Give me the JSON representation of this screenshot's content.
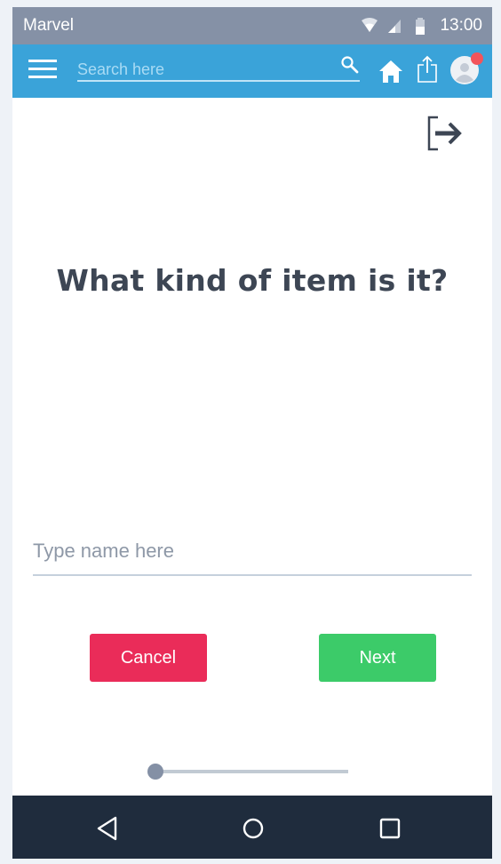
{
  "status_bar": {
    "carrier": "Marvel",
    "time": "13:00",
    "icons": [
      "wifi-icon",
      "signal-icon",
      "battery-icon"
    ]
  },
  "app_bar": {
    "menu_icon": "hamburger-menu-icon",
    "search": {
      "placeholder": "Search here",
      "value": "",
      "icon": "search-icon"
    },
    "actions": [
      "home-icon",
      "share-icon",
      "avatar-icon"
    ],
    "notification_color": "#f2545b"
  },
  "main": {
    "exit_icon": "exit-icon",
    "question": "What kind of item is it?",
    "name_input": {
      "placeholder": "Type name here",
      "value": ""
    },
    "buttons": {
      "cancel_label": "Cancel",
      "next_label": "Next"
    },
    "progress": {
      "value": 0
    }
  },
  "nav_bar": {
    "items": [
      "back-icon",
      "home-circle-icon",
      "recents-icon"
    ]
  },
  "colors": {
    "status_bar": "#8591a6",
    "app_bar": "#3aa3d9",
    "cancel": "#ea2c59",
    "next": "#3ccb69",
    "nav_bar": "#1f2c3d"
  }
}
